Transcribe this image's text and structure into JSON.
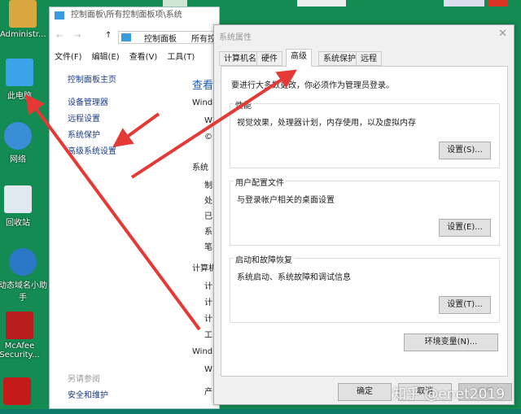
{
  "desktop": {
    "icons": [
      {
        "label": "Administr..."
      },
      {
        "label": "此电脑"
      },
      {
        "label": "网络"
      },
      {
        "label": "回收站"
      },
      {
        "label": "动态域名小助手"
      },
      {
        "label": "McAfee Security..."
      }
    ]
  },
  "explorer": {
    "title": "控制面板\\所有控制面板项\\系统",
    "address": [
      "控制面板",
      "所有控"
    ],
    "menu": [
      "文件(F)",
      "编辑(E)",
      "查看(V)",
      "工具(T)"
    ],
    "nav": [
      "控制面板主页",
      "设备管理器",
      "远程设置",
      "系统保护",
      "高级系统设置"
    ],
    "see_also": "另请参阅",
    "see_also_link": "安全和维护",
    "main_heading": "查看",
    "sections": [
      "Wind",
      "W",
      "©",
      "系统",
      "制",
      "处",
      "已",
      "系",
      "笔",
      "计算机",
      "计",
      "计",
      "计",
      "工",
      "Wind",
      "W",
      "产"
    ]
  },
  "dialog": {
    "title": "系统属性",
    "tabs": [
      "计算机名",
      "硬件",
      "高级",
      "系统保护",
      "远程"
    ],
    "active_tab": "高级",
    "notice": "要进行大多数更改，你必须作为管理员登录。",
    "groups": [
      {
        "legend": "性能",
        "desc": "视觉效果，处理器计划，内存使用，以及虚拟内存",
        "button": "设置(S)..."
      },
      {
        "legend": "用户配置文件",
        "desc": "与登录帐户相关的桌面设置",
        "button": "设置(E)..."
      },
      {
        "legend": "启动和故障恢复",
        "desc": "系统启动、系统故障和调试信息",
        "button": "设置(T)..."
      }
    ],
    "env_button": "环境变量(N)...",
    "ok": "确定",
    "cancel": "取消",
    "apply": "应用"
  },
  "watermark": "知乎 @enet2019",
  "colors": {
    "desktop": "#138b52",
    "arrow": "#e53935",
    "link": "#1a3c8a"
  }
}
